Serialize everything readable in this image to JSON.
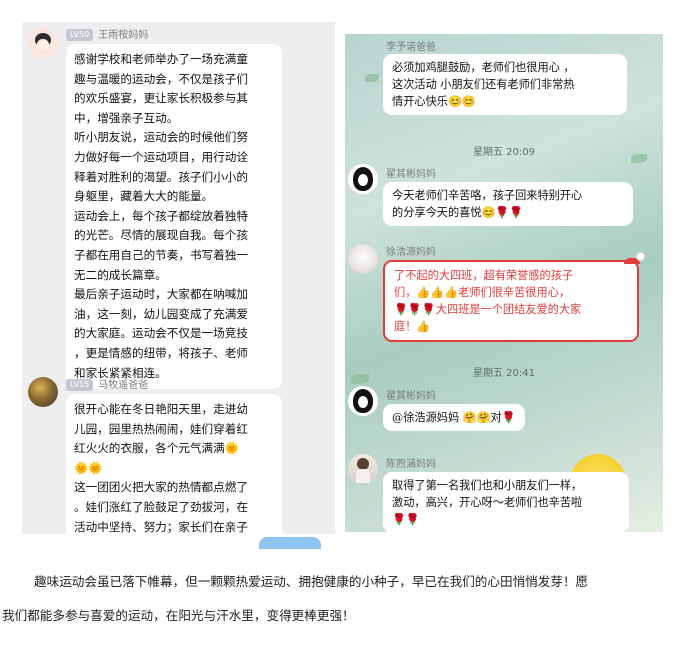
{
  "left_chat": {
    "messages": [
      {
        "level": "LV50",
        "sender": "王雨桉妈妈",
        "lines": [
          "感谢学校和老师举办了一场充满童",
          "趣与温暖的运动会，不仅是孩子们",
          "的欢乐盛宴，更让家长积极参与其",
          "中，增强亲子互动。",
          "听小朋友说，运动会的时候他们努",
          "力做好每一个运动项目，用行动诠",
          "释着对胜利的渴望。孩子们小小的",
          "身躯里，藏着大大的能量。",
          "运动会上，每个孩子都绽放着独特",
          "的光芒。尽情的展现自我。每个孩",
          "子都在用自己的节奏，书写着独一",
          "无二的成长篇章。",
          "最后亲子运动时，大家都在呐喊加",
          "油，这一刻，幼儿园变成了充满爱",
          "的大家庭。运动会不仅是一场竞技",
          "，更是情感的纽带，将孩子、老师",
          "和家长紧紧相连。"
        ]
      },
      {
        "level": "LV15",
        "sender": "马牧遥爸爸",
        "lines": [
          "很开心能在冬日艳阳天里，走进幼",
          "儿园，园里热热闹闹，娃们穿着红",
          "红火火的衣服，各个元气满满🌞",
          "🌞🌞",
          "这一团团火把大家的热情都点燃了",
          "。娃们涨红了脸鼓足了劲拔河，在",
          "活动中坚持、努力；家长们在亲子"
        ]
      }
    ]
  },
  "right_chat": {
    "messages": [
      {
        "sender": "李予诺爸爸",
        "lines": [
          "必须加鸡腿鼓励，老师们也很用心 ，",
          "这次活动 小朋友们还有老师们非常热",
          "情开心快乐😊😊"
        ]
      },
      {
        "timestamp": "星期五 20:09"
      },
      {
        "sender": "翟其彬妈妈",
        "lines": [
          "今天老师们辛苦咯，孩子回来特别开心",
          "的分享今天的喜悦😊🌹🌹"
        ]
      },
      {
        "sender": "徐浩源妈妈",
        "lines": [
          "了不起的大四班，超有荣誉感的孩子",
          "们，👍👍👍老师们很辛苦很用心，",
          "🌹🌹🌹大四班是一个团结友爱的大家",
          "庭！👍"
        ]
      },
      {
        "timestamp": "星期五 20:41"
      },
      {
        "sender": "翟其彬妈妈",
        "lines": [
          "@徐浩源妈妈 🤗🤗对🌹"
        ]
      },
      {
        "sender": "陈煦涵妈妈",
        "lines": [
          "取得了第一名我们也和小朋友们一样，",
          "激动，高兴，开心呀～老师们也辛苦啦",
          "🌹🌹"
        ]
      }
    ]
  },
  "caption": {
    "line1": "趣味运动会虽已落下帷幕，但一颗颗热爱运动、拥抱健康的小种子，早已在我们的心田悄悄发芽！愿",
    "line2": "我们都能多参与喜爱的运动，在阳光与汗水里，变得更棒更强！"
  },
  "colors": {
    "festive_red": "#e23b3b",
    "accent_blue": "#8ec5ee"
  }
}
